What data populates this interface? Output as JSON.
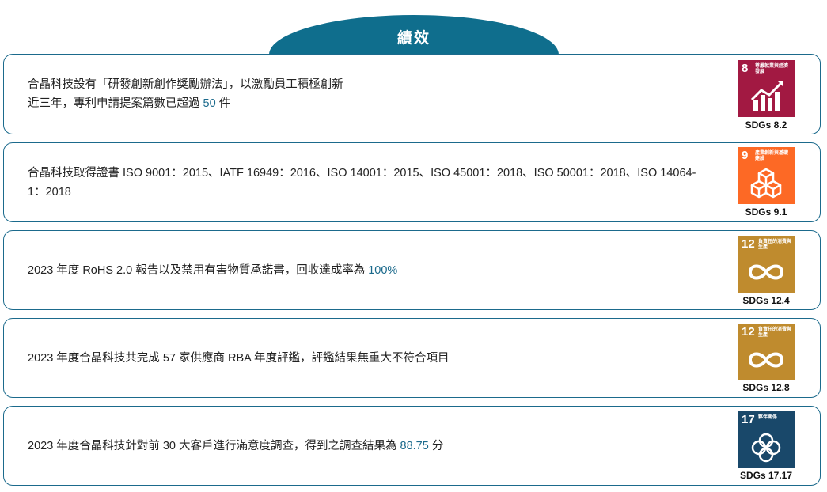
{
  "header": {
    "title": "績效"
  },
  "colors": {
    "accent": "#1b6a8c",
    "sdg8": "#a21942",
    "sdg9": "#fd6925",
    "sdg12": "#bf8b2e",
    "sdg17": "#19486a"
  },
  "cards": [
    {
      "lines": [
        "合晶科技設有「研發創新創作獎勵辦法」，以激勵員工積極創新",
        "近三年，專利申請提案篇數已超過 "
      ],
      "highlight": "50",
      "suffix": " 件",
      "sdg": {
        "number": "8",
        "label": "尊嚴就業與經濟發展",
        "icon": "growth-chart-icon",
        "caption": "SDGs 8.2"
      }
    },
    {
      "lines": [
        "合晶科技取得證書 ISO 9001：2015、IATF 16949：2016、ISO 14001：2015、ISO 45001：2018、ISO 50001：2018、ISO 14064-1：2018"
      ],
      "sdg": {
        "number": "9",
        "label": "產業創新與基礎建設",
        "icon": "cubes-icon",
        "caption": "SDGs 9.1"
      }
    },
    {
      "prefix": "2023 年度 RoHS 2.0 報告以及禁用有害物質承諾書，回收達成率為 ",
      "highlight": "100%",
      "sdg": {
        "number": "12",
        "label": "負責任的消費與生產",
        "icon": "infinity-icon",
        "caption": "SDGs 12.4"
      }
    },
    {
      "prefix": "2023 年度合晶科技共完成 57 家供應商 RBA 年度評鑑，評鑑結果無重大不符合項目",
      "sdg": {
        "number": "12",
        "label": "負責任的消費與生產",
        "icon": "infinity-icon",
        "caption": "SDGs 12.8"
      }
    },
    {
      "prefix": "2023 年度合晶科技針對前 30 大客戶進行滿意度調查，得到之調查結果為 ",
      "highlight": "88.75",
      "suffix": " 分",
      "sdg": {
        "number": "17",
        "label": "夥伴關係",
        "icon": "flower-rings-icon",
        "caption": "SDGs 17.17"
      }
    }
  ]
}
